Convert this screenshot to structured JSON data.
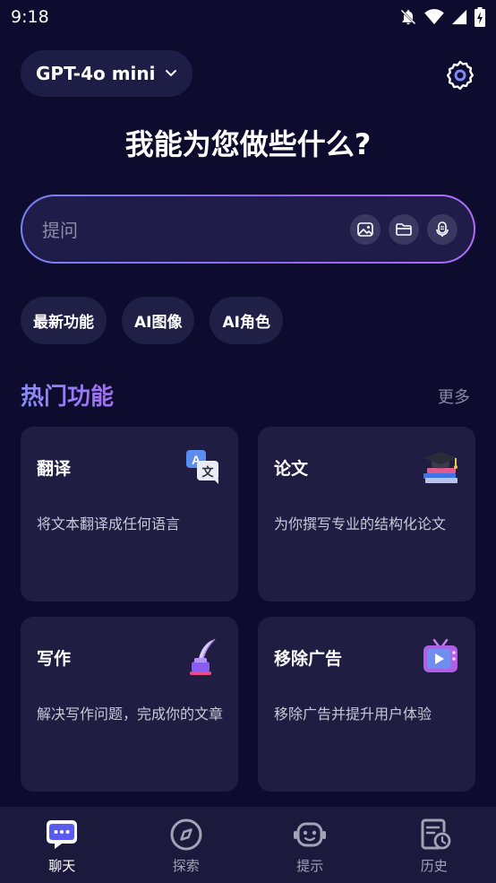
{
  "status_bar": {
    "time": "9:18"
  },
  "header": {
    "model_label": "GPT-4o mini"
  },
  "headline": "我能为您做些什么?",
  "search": {
    "placeholder": "提问"
  },
  "chips": [
    {
      "label": "最新功能"
    },
    {
      "label": "AI图像"
    },
    {
      "label": "AI角色"
    }
  ],
  "section": {
    "title": "热门功能",
    "more_label": "更多"
  },
  "cards": [
    {
      "title": "翻译",
      "desc": "将文本翻译成任何语言",
      "icon": "translate-icon"
    },
    {
      "title": "论文",
      "desc": "为你撰写专业的结构化论文",
      "icon": "graduation-cap-icon"
    },
    {
      "title": "写作",
      "desc": "解决写作问题，完成你的文章",
      "icon": "quill-icon"
    },
    {
      "title": "移除广告",
      "desc": "移除广告并提升用户体验",
      "icon": "tv-icon"
    }
  ],
  "nav": [
    {
      "label": "聊天",
      "icon": "chat-icon",
      "active": true
    },
    {
      "label": "探索",
      "icon": "compass-icon",
      "active": false
    },
    {
      "label": "提示",
      "icon": "robot-icon",
      "active": false
    },
    {
      "label": "历史",
      "icon": "history-icon",
      "active": false
    }
  ],
  "colors": {
    "background": "#0d0b2e",
    "card": "#1f1e42",
    "accent_start": "#7a82f0",
    "accent_end": "#b06cf5"
  }
}
